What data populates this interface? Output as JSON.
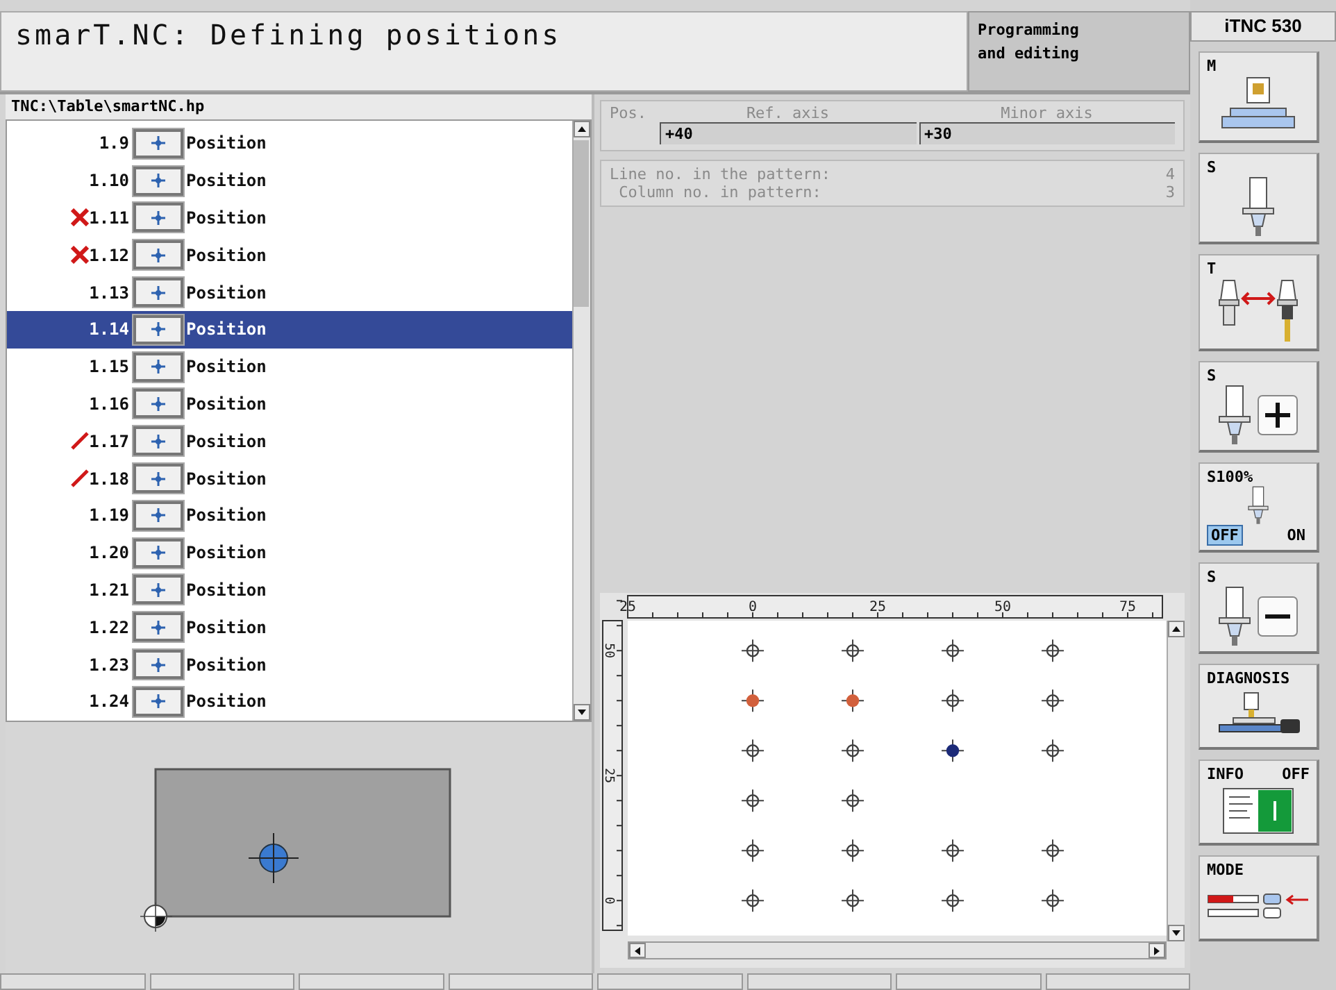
{
  "header": {
    "title": "smarT.NC: Defining positions",
    "mode_lines": [
      "Programming",
      "and editing"
    ],
    "brand": "iTNC 530"
  },
  "tree": {
    "path": "TNC:\\Table\\smartNC.hp",
    "rows": [
      {
        "number": "1.9",
        "label": "Position",
        "kind": "plain",
        "selected": false
      },
      {
        "number": "1.10",
        "label": "Position",
        "kind": "plain",
        "selected": false
      },
      {
        "number": "1.11",
        "label": "Position",
        "kind": "deleted",
        "selected": false
      },
      {
        "number": "1.12",
        "label": "Position",
        "kind": "deleted",
        "selected": false
      },
      {
        "number": "1.13",
        "label": "Position",
        "kind": "plain",
        "selected": false
      },
      {
        "number": "1.14",
        "label": "Position",
        "kind": "plain",
        "selected": true
      },
      {
        "number": "1.15",
        "label": "Position",
        "kind": "plain",
        "selected": false
      },
      {
        "number": "1.16",
        "label": "Position",
        "kind": "plain",
        "selected": false
      },
      {
        "number": "1.17",
        "label": "Position",
        "kind": "skipped",
        "selected": false
      },
      {
        "number": "1.18",
        "label": "Position",
        "kind": "skipped",
        "selected": false
      },
      {
        "number": "1.19",
        "label": "Position",
        "kind": "plain",
        "selected": false
      },
      {
        "number": "1.20",
        "label": "Position",
        "kind": "plain",
        "selected": false
      },
      {
        "number": "1.21",
        "label": "Position",
        "kind": "plain",
        "selected": false
      },
      {
        "number": "1.22",
        "label": "Position",
        "kind": "plain",
        "selected": false
      },
      {
        "number": "1.23",
        "label": "Position",
        "kind": "plain",
        "selected": false
      },
      {
        "number": "1.24",
        "label": "Position",
        "kind": "plain",
        "selected": false
      }
    ]
  },
  "form": {
    "pos_label": "Pos.",
    "columns": [
      "Ref. axis",
      "Minor axis"
    ],
    "values": [
      "+40",
      "+30"
    ],
    "info": [
      {
        "label": "Line no. in the pattern:",
        "value": "4"
      },
      {
        "label": " Column no. in pattern:",
        "value": "3"
      }
    ]
  },
  "graphic": {
    "chart_data": {
      "type": "scatter",
      "xlim": [
        -25,
        83
      ],
      "ylim": [
        -7,
        56
      ],
      "xticks": [
        {
          "value": -25,
          "label": "25"
        },
        0,
        25,
        50,
        75
      ],
      "yticks": [
        50,
        25,
        0
      ],
      "series": [
        {
          "color": "#404040",
          "x": [
            0,
            20,
            40,
            60,
            40,
            60,
            0,
            20,
            60,
            0,
            20,
            0,
            20,
            40,
            60,
            0,
            20,
            40,
            60
          ],
          "values": [
            50,
            50,
            50,
            50,
            40,
            40,
            30,
            30,
            30,
            20,
            20,
            10,
            10,
            10,
            10,
            0,
            0,
            0,
            0
          ]
        },
        {
          "color": "#d2603c",
          "x": [
            0,
            20
          ],
          "values": [
            40,
            40
          ]
        },
        {
          "color": "#1c2a78",
          "x": [
            40
          ],
          "values": [
            30
          ]
        }
      ]
    }
  },
  "softkeys": [
    {
      "kind": "machine",
      "label": "M"
    },
    {
      "kind": "spindle",
      "label": "S"
    },
    {
      "kind": "tool-change",
      "label": "T"
    },
    {
      "kind": "spindle-plus",
      "label": "S"
    },
    {
      "kind": "override",
      "label": "S100%",
      "options": [
        {
          "label": "OFF",
          "selected": true
        },
        {
          "label": "ON",
          "selected": false
        }
      ]
    },
    {
      "kind": "spindle-minus",
      "label": "S"
    },
    {
      "kind": "diagnosis",
      "label": "DIAGNOSIS"
    },
    {
      "kind": "info",
      "label": "INFO",
      "option": "OFF"
    },
    {
      "kind": "mode",
      "label": "MODE"
    }
  ]
}
